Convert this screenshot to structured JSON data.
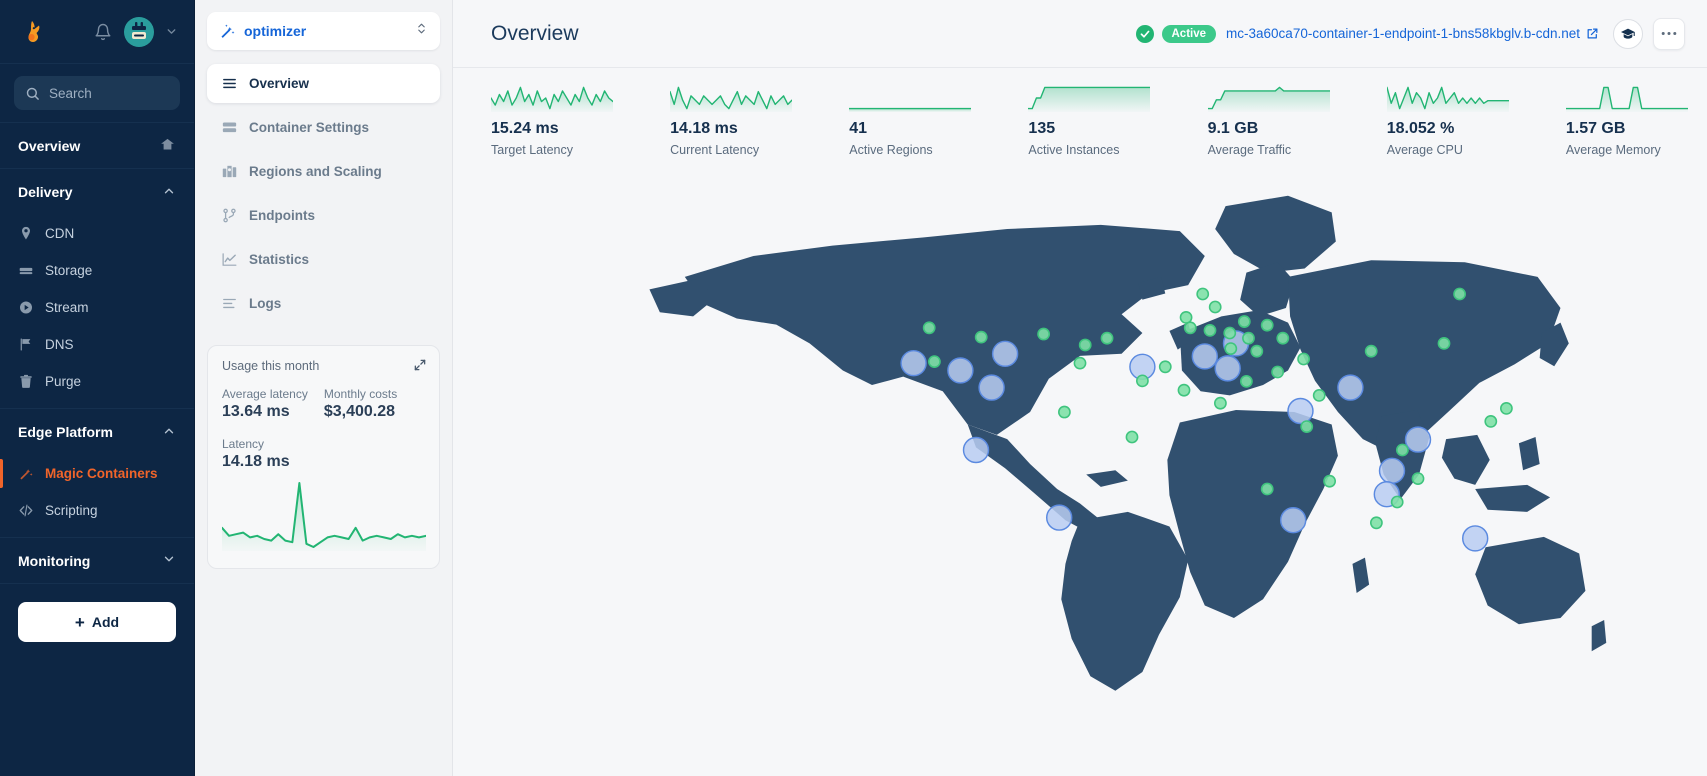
{
  "leftnav": {
    "logo_icon": "bunny-logo-icon",
    "bell_icon": "bell-icon",
    "avatar_icon": "user-avatar-icon",
    "account_caret_icon": "chevron-down-icon",
    "search": {
      "placeholder": "Search",
      "value": "",
      "icon": "search-icon"
    },
    "overview": {
      "label": "Overview",
      "icon": "home-icon"
    },
    "sections": [
      {
        "label": "Delivery",
        "caret": "chevron-up-icon",
        "items": [
          {
            "label": "CDN",
            "icon": "location-pin-icon",
            "active": false
          },
          {
            "label": "Storage",
            "icon": "storage-drive-icon",
            "active": false
          },
          {
            "label": "Stream",
            "icon": "play-circle-icon",
            "active": false
          },
          {
            "label": "DNS",
            "icon": "flag-icon",
            "active": false
          },
          {
            "label": "Purge",
            "icon": "trash-icon",
            "active": false
          }
        ]
      },
      {
        "label": "Edge Platform",
        "caret": "chevron-up-icon",
        "items": [
          {
            "label": "Magic Containers",
            "icon": "magic-wand-icon",
            "active": true
          },
          {
            "label": "Scripting",
            "icon": "code-brackets-icon",
            "active": false
          }
        ]
      }
    ],
    "monitoring": {
      "label": "Monitoring",
      "caret": "chevron-down-icon"
    },
    "add_button": {
      "label": "Add",
      "icon": "plus-icon"
    }
  },
  "subnav": {
    "project": {
      "name": "optimizer",
      "icon": "magic-wand-icon",
      "caret": "chevron-up-down-icon"
    },
    "items": [
      {
        "label": "Overview",
        "icon": "list-icon",
        "active": true
      },
      {
        "label": "Container Settings",
        "icon": "server-stack-icon",
        "active": false
      },
      {
        "label": "Regions and Scaling",
        "icon": "map-regions-icon",
        "active": false
      },
      {
        "label": "Endpoints",
        "icon": "branch-icon",
        "active": false
      },
      {
        "label": "Statistics",
        "icon": "line-chart-icon",
        "active": false
      },
      {
        "label": "Logs",
        "icon": "logs-icon",
        "active": false
      }
    ],
    "usage_card": {
      "title": "Usage this month",
      "expand_icon": "expand-icon",
      "metrics": [
        {
          "label": "Average latency",
          "value": "13.64 ms"
        },
        {
          "label": "Monthly costs",
          "value": "$3,400.28"
        }
      ],
      "chart_label": "Latency",
      "chart_value": "14.18 ms"
    }
  },
  "topbar": {
    "title": "Overview",
    "status_icon": "check-circle-icon",
    "status_badge": "Active",
    "hostname": "mc-3a60ca70-container-1-endpoint-1-bns58kbglv.b-cdn.net",
    "external_link_icon": "external-link-icon",
    "academy_icon": "graduation-cap-icon",
    "more_icon": "ellipsis-icon"
  },
  "stats": [
    {
      "value": "15.24 ms",
      "label": "Target Latency"
    },
    {
      "value": "14.18 ms",
      "label": "Current Latency"
    },
    {
      "value": "41",
      "label": "Active Regions"
    },
    {
      "value": "135",
      "label": "Active Instances"
    },
    {
      "value": "9.1 GB",
      "label": "Average Traffic"
    },
    {
      "value": "18.052 %",
      "label": "Average CPU"
    },
    {
      "value": "1.57 GB",
      "label": "Average Memory"
    }
  ],
  "colors": {
    "nav_bg": "#0d2644",
    "accent_orange": "#f0642a",
    "link_blue": "#1565d8",
    "status_green": "#3cc98a",
    "spark_green": "#22b573",
    "map_land": "#31506f",
    "map_dot_green": "#5fd38d",
    "map_dot_blue": "#a9c4f0"
  },
  "chart_data": [
    {
      "type": "area",
      "title": "Target Latency",
      "ylabel": "ms",
      "values": [
        15.3,
        15.1,
        15.4,
        15.2,
        15.5,
        15.1,
        15.3,
        15.6,
        15.2,
        15.4,
        15.1,
        15.5,
        15.2,
        15.3,
        15.0,
        15.4,
        15.2,
        15.5,
        15.3,
        15.1,
        15.4,
        15.2,
        15.6,
        15.3,
        15.1,
        15.4,
        15.2,
        15.5,
        15.3,
        15.2
      ],
      "ylim": [
        14.5,
        16.0
      ]
    },
    {
      "type": "area",
      "title": "Current Latency",
      "ylabel": "ms",
      "values": [
        14.4,
        14.1,
        14.5,
        14.2,
        14.0,
        14.3,
        14.2,
        14.1,
        14.3,
        14.2,
        14.1,
        14.2,
        14.3,
        14.1,
        14.0,
        14.2,
        14.4,
        14.1,
        14.3,
        14.2,
        14.1,
        14.4,
        14.2,
        14.0,
        14.3,
        14.1,
        14.2,
        14.3,
        14.1,
        14.2
      ],
      "ylim": [
        13.5,
        15.0
      ]
    },
    {
      "type": "area",
      "title": "Active Regions",
      "values": [
        41,
        41,
        41,
        41,
        41,
        41,
        41,
        41,
        41,
        41,
        41,
        41,
        41,
        41,
        41,
        41,
        41,
        41,
        41,
        41,
        41,
        41,
        41,
        41,
        41,
        41,
        41,
        41,
        41,
        41
      ],
      "ylim": [
        0,
        45
      ]
    },
    {
      "type": "area",
      "title": "Active Instances",
      "values": [
        133,
        133,
        134,
        134,
        135,
        135,
        135,
        135,
        135,
        135,
        135,
        135,
        135,
        135,
        135,
        135,
        135,
        135,
        135,
        135,
        135,
        135,
        135,
        135,
        135,
        135,
        135,
        135,
        135,
        135
      ],
      "ylim": [
        0,
        140
      ]
    },
    {
      "type": "area",
      "title": "Average Traffic",
      "ylabel": "GB",
      "values": [
        9.0,
        9.0,
        9.05,
        9.05,
        9.1,
        9.1,
        9.1,
        9.1,
        9.1,
        9.1,
        9.1,
        9.1,
        9.1,
        9.1,
        9.1,
        9.1,
        9.1,
        9.12,
        9.1,
        9.1,
        9.1,
        9.1,
        9.1,
        9.1,
        9.1,
        9.1,
        9.1,
        9.1,
        9.1,
        9.1
      ],
      "ylim": [
        0,
        9.5
      ]
    },
    {
      "type": "area",
      "title": "Average CPU",
      "ylabel": "%",
      "values": [
        18.3,
        18.0,
        18.2,
        17.9,
        18.1,
        18.3,
        18.0,
        18.2,
        18.1,
        17.9,
        18.2,
        18.0,
        18.1,
        18.3,
        18.0,
        18.1,
        18.2,
        18.0,
        18.1,
        18.0,
        18.1,
        18.0,
        18.1,
        18.0,
        18.05,
        18.05,
        18.05,
        18.05,
        18.05,
        18.05
      ],
      "ylim": [
        0,
        19
      ]
    },
    {
      "type": "area",
      "title": "Average Memory",
      "ylabel": "GB",
      "values": [
        1.57,
        1.57,
        1.57,
        1.57,
        1.57,
        1.57,
        1.57,
        1.57,
        1.57,
        1.58,
        1.58,
        1.57,
        1.57,
        1.57,
        1.57,
        1.57,
        1.58,
        1.58,
        1.57,
        1.57,
        1.57,
        1.57,
        1.57,
        1.57,
        1.57,
        1.57,
        1.57,
        1.57,
        1.57,
        1.57
      ],
      "ylim": [
        0,
        1.7
      ]
    },
    {
      "type": "area",
      "title": "Latency",
      "ylabel": "ms",
      "values": [
        14.4,
        13.9,
        14.0,
        14.1,
        13.8,
        13.9,
        13.7,
        13.6,
        14.0,
        13.6,
        13.5,
        17.2,
        13.4,
        13.2,
        13.5,
        13.8,
        13.9,
        13.8,
        13.7,
        14.4,
        13.6,
        13.8,
        13.9,
        13.8,
        13.7,
        14.0,
        13.8,
        13.9,
        13.8,
        13.9
      ],
      "ylim": [
        13.0,
        17.5
      ]
    }
  ],
  "map": {
    "green_points": [
      [
        35.5,
        29.0
      ],
      [
        40.5,
        30.8
      ],
      [
        46.5,
        30.2
      ],
      [
        52.6,
        31.0
      ],
      [
        50.5,
        32.3
      ],
      [
        36.0,
        35.5
      ],
      [
        50.0,
        35.8
      ],
      [
        56.0,
        39.2
      ],
      [
        48.5,
        45.2
      ],
      [
        60.0,
        41.0
      ],
      [
        60.2,
        27.0
      ],
      [
        61.8,
        22.5
      ],
      [
        63.0,
        25.0
      ],
      [
        60.6,
        29.0
      ],
      [
        62.5,
        29.5
      ],
      [
        64.4,
        30.0
      ],
      [
        65.8,
        27.8
      ],
      [
        66.2,
        31.0
      ],
      [
        64.5,
        33.0
      ],
      [
        67.0,
        33.5
      ],
      [
        69.5,
        31.0
      ],
      [
        68.0,
        28.5
      ],
      [
        58.2,
        36.5
      ],
      [
        69.0,
        37.5
      ],
      [
        66.0,
        39.3
      ],
      [
        71.5,
        35.0
      ],
      [
        63.5,
        43.5
      ],
      [
        73.0,
        42.0
      ],
      [
        78.0,
        33.5
      ],
      [
        85.0,
        32.0
      ],
      [
        81.0,
        52.5
      ],
      [
        82.5,
        58.0
      ],
      [
        80.5,
        62.5
      ],
      [
        78.5,
        66.5
      ],
      [
        71.8,
        48.0
      ],
      [
        68.0,
        60.0
      ],
      [
        89.5,
        47.0
      ],
      [
        91.0,
        44.5
      ],
      [
        86.5,
        22.5
      ],
      [
        74.0,
        58.5
      ],
      [
        55.0,
        50.0
      ]
    ],
    "blue_points": [
      [
        42.8,
        34.0
      ],
      [
        38.5,
        37.2
      ],
      [
        34.0,
        35.8
      ],
      [
        41.5,
        40.5
      ],
      [
        56.0,
        36.5
      ],
      [
        40.0,
        52.5
      ],
      [
        48.0,
        65.5
      ],
      [
        62.0,
        34.5
      ],
      [
        65.0,
        32.0
      ],
      [
        64.2,
        36.8
      ],
      [
        71.2,
        45.0
      ],
      [
        76.0,
        40.5
      ],
      [
        82.5,
        50.5
      ],
      [
        80.0,
        56.5
      ],
      [
        79.5,
        61.0
      ],
      [
        88.0,
        69.5
      ],
      [
        70.5,
        66.0
      ]
    ]
  }
}
